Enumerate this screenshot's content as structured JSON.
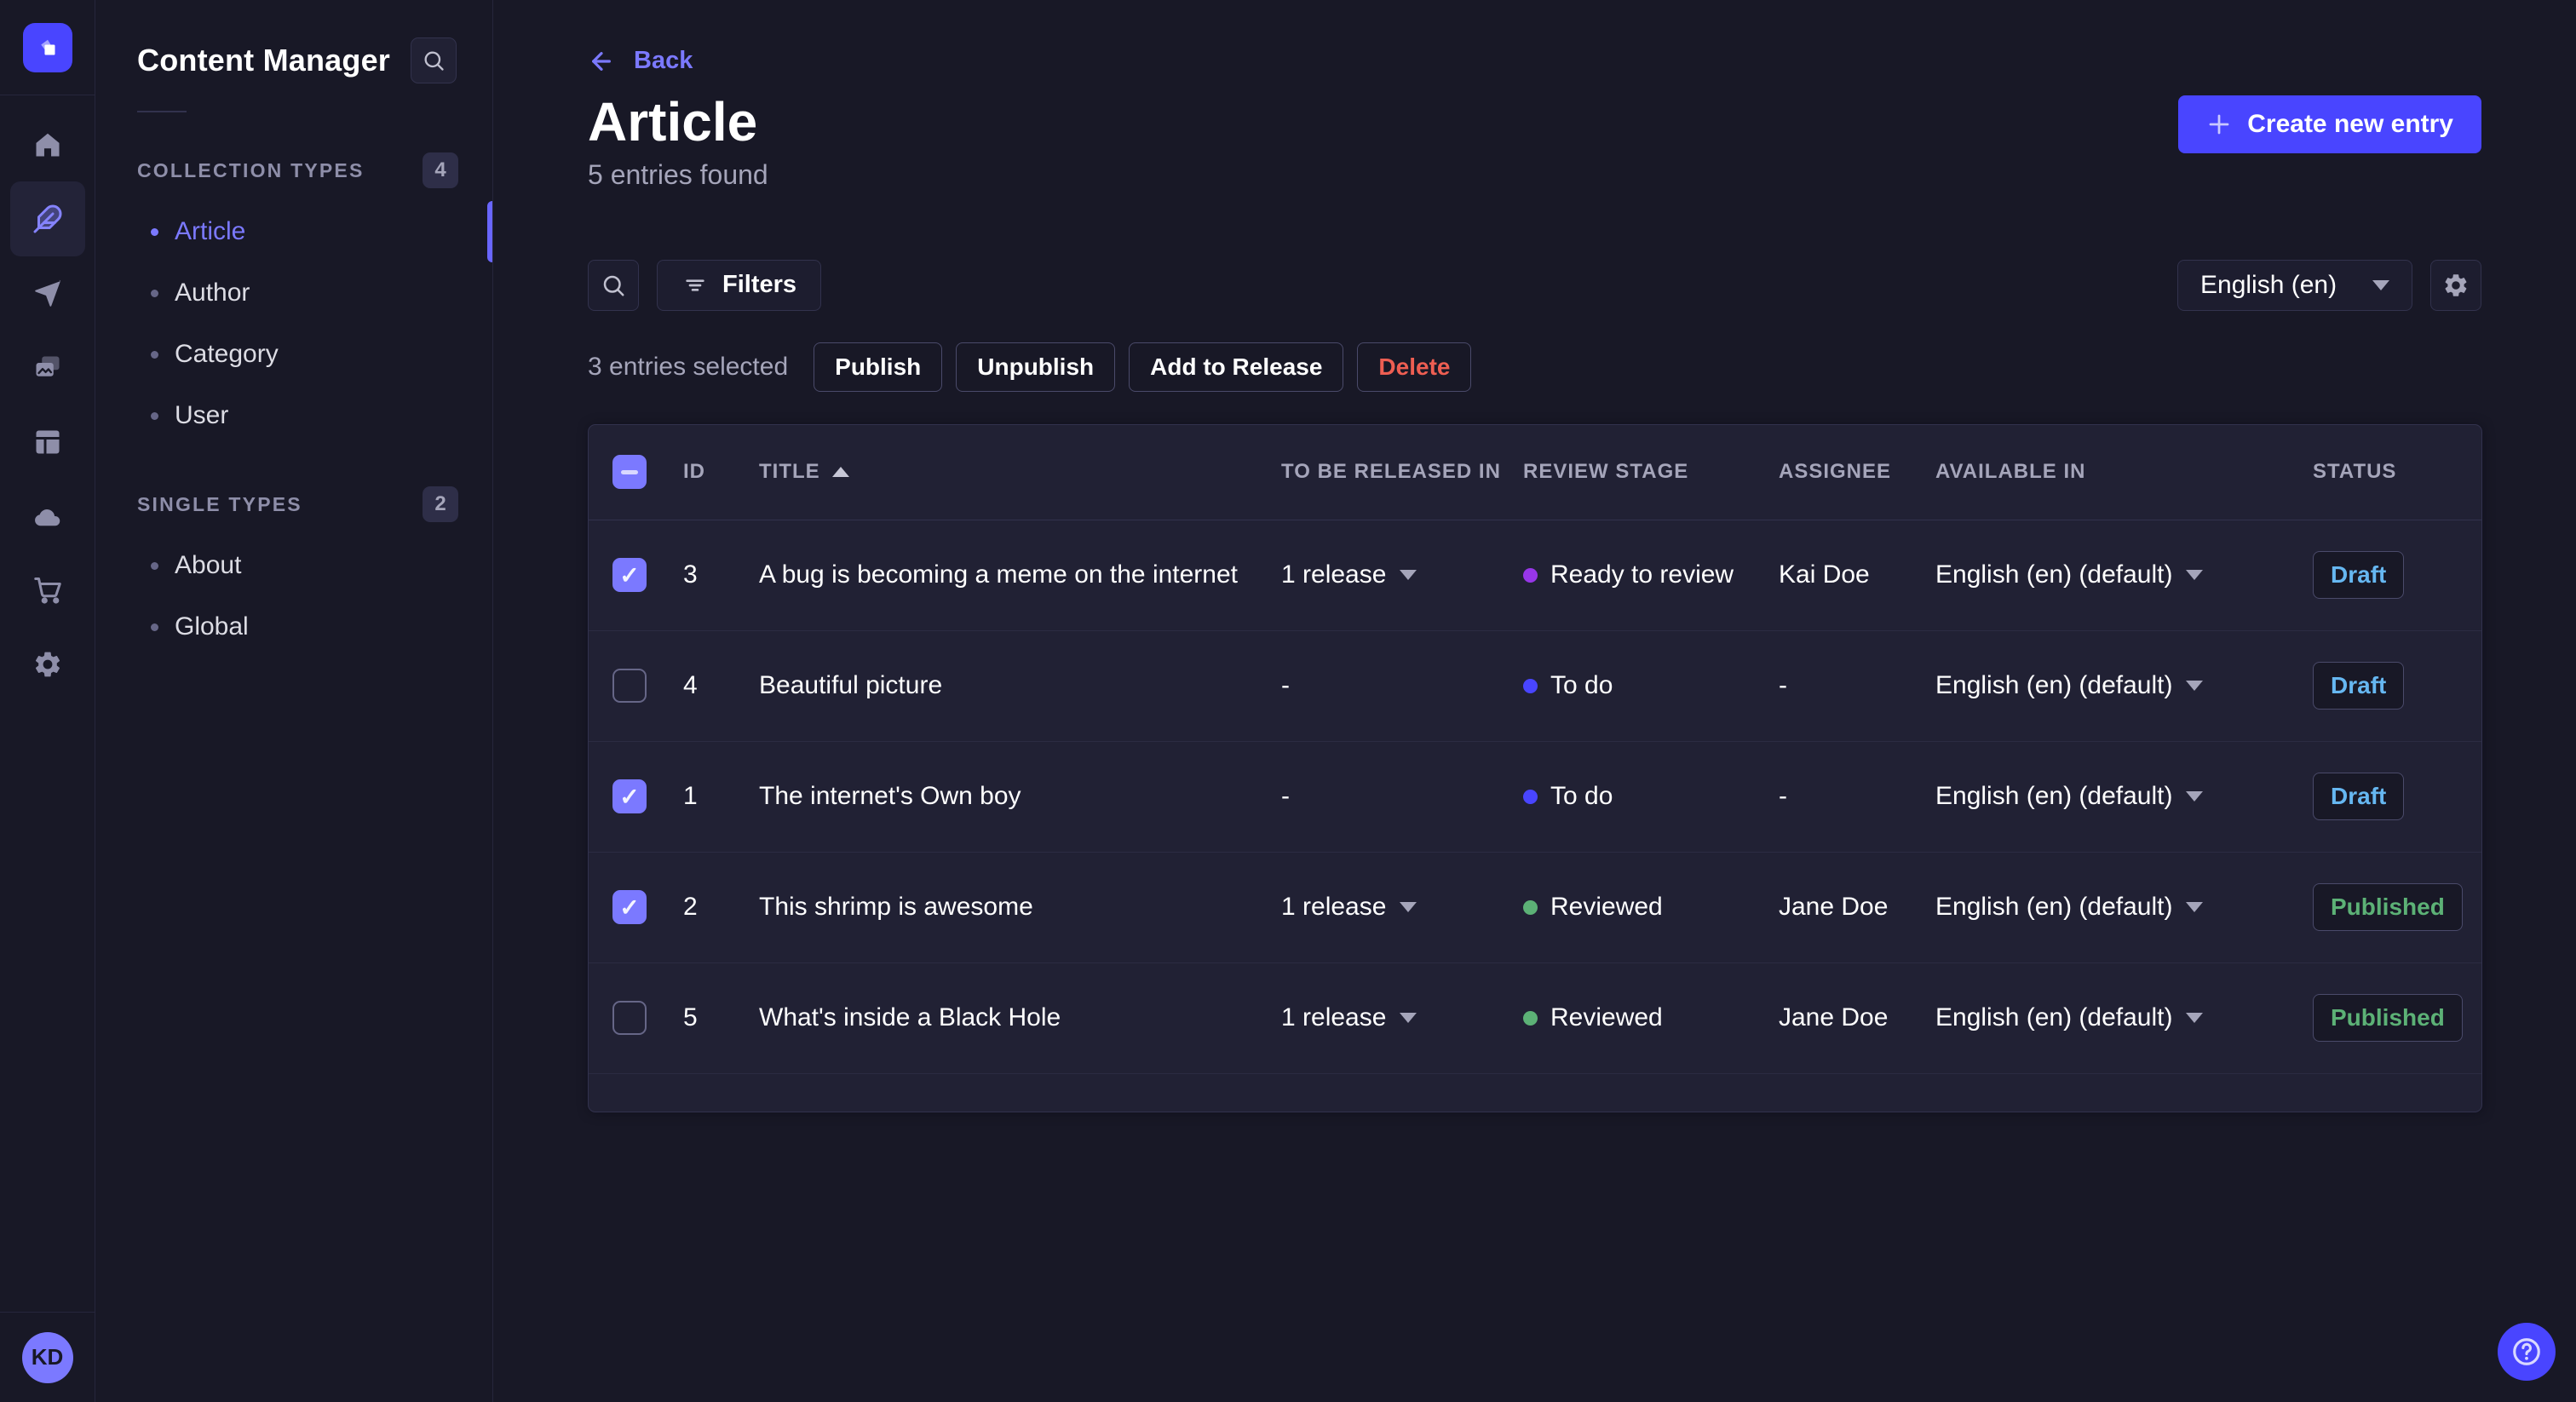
{
  "rail": {
    "avatar_initials": "KD",
    "items": [
      {
        "name": "home"
      },
      {
        "name": "content-manager",
        "active": true
      },
      {
        "name": "releases"
      },
      {
        "name": "media-library"
      },
      {
        "name": "content-type-builder"
      },
      {
        "name": "deploy"
      },
      {
        "name": "marketplace"
      },
      {
        "name": "settings"
      }
    ]
  },
  "sidebar": {
    "title": "Content Manager",
    "sections": [
      {
        "label": "COLLECTION TYPES",
        "count": "4",
        "items": [
          {
            "label": "Article",
            "active": true
          },
          {
            "label": "Author"
          },
          {
            "label": "Category"
          },
          {
            "label": "User"
          }
        ]
      },
      {
        "label": "SINGLE TYPES",
        "count": "2",
        "items": [
          {
            "label": "About"
          },
          {
            "label": "Global"
          }
        ]
      }
    ]
  },
  "header": {
    "back_label": "Back",
    "title": "Article",
    "subtitle": "5 entries found",
    "create_button": "Create new entry"
  },
  "toolbar": {
    "filters_button": "Filters",
    "locale_selected": "English (en)"
  },
  "selection": {
    "summary": "3 entries selected",
    "publish_button": "Publish",
    "unpublish_button": "Unpublish",
    "add_to_release_button": "Add to Release",
    "delete_button": "Delete"
  },
  "table": {
    "select_all_state": "indeterminate",
    "sort": {
      "column": "TITLE",
      "direction": "asc"
    },
    "columns": [
      {
        "label": "ID"
      },
      {
        "label": "TITLE"
      },
      {
        "label": "TO BE RELEASED IN"
      },
      {
        "label": "REVIEW STAGE"
      },
      {
        "label": "ASSIGNEE"
      },
      {
        "label": "AVAILABLE IN"
      },
      {
        "label": "STATUS"
      }
    ],
    "rows": [
      {
        "checked": true,
        "id": "3",
        "title": "A bug is becoming a meme on the internet",
        "release": "1 release",
        "stage": "Ready to review",
        "stage_color": "#9736e8",
        "assignee": "Kai Doe",
        "locale": "English (en) (default)",
        "status": "Draft"
      },
      {
        "checked": false,
        "id": "4",
        "title": "Beautiful picture",
        "release": "-",
        "stage": "To do",
        "stage_color": "#4945ff",
        "assignee": "-",
        "locale": "English (en) (default)",
        "status": "Draft"
      },
      {
        "checked": true,
        "id": "1",
        "title": "The internet's Own boy",
        "release": "-",
        "stage": "To do",
        "stage_color": "#4945ff",
        "assignee": "-",
        "locale": "English (en) (default)",
        "status": "Draft"
      },
      {
        "checked": true,
        "id": "2",
        "title": "This shrimp is awesome",
        "release": "1 release",
        "stage": "Reviewed",
        "stage_color": "#5cb176",
        "assignee": "Jane Doe",
        "locale": "English (en) (default)",
        "status": "Published"
      },
      {
        "checked": false,
        "id": "5",
        "title": "What's inside a Black Hole",
        "release": "1 release",
        "stage": "Reviewed",
        "stage_color": "#5cb176",
        "assignee": "Jane Doe",
        "locale": "English (en) (default)",
        "status": "Published"
      }
    ]
  },
  "colors": {
    "primary": "#4945ff",
    "primary_light": "#7b79ff",
    "page_bg": "#181826",
    "surface_bg": "#212134",
    "border": "#32324d",
    "draft_text": "#66b7f1",
    "published_text": "#5cb176",
    "danger_text": "#ee5e52",
    "stage_todo": "#4945ff",
    "stage_ready_to_review": "#9736e8",
    "stage_reviewed": "#5cb176"
  }
}
